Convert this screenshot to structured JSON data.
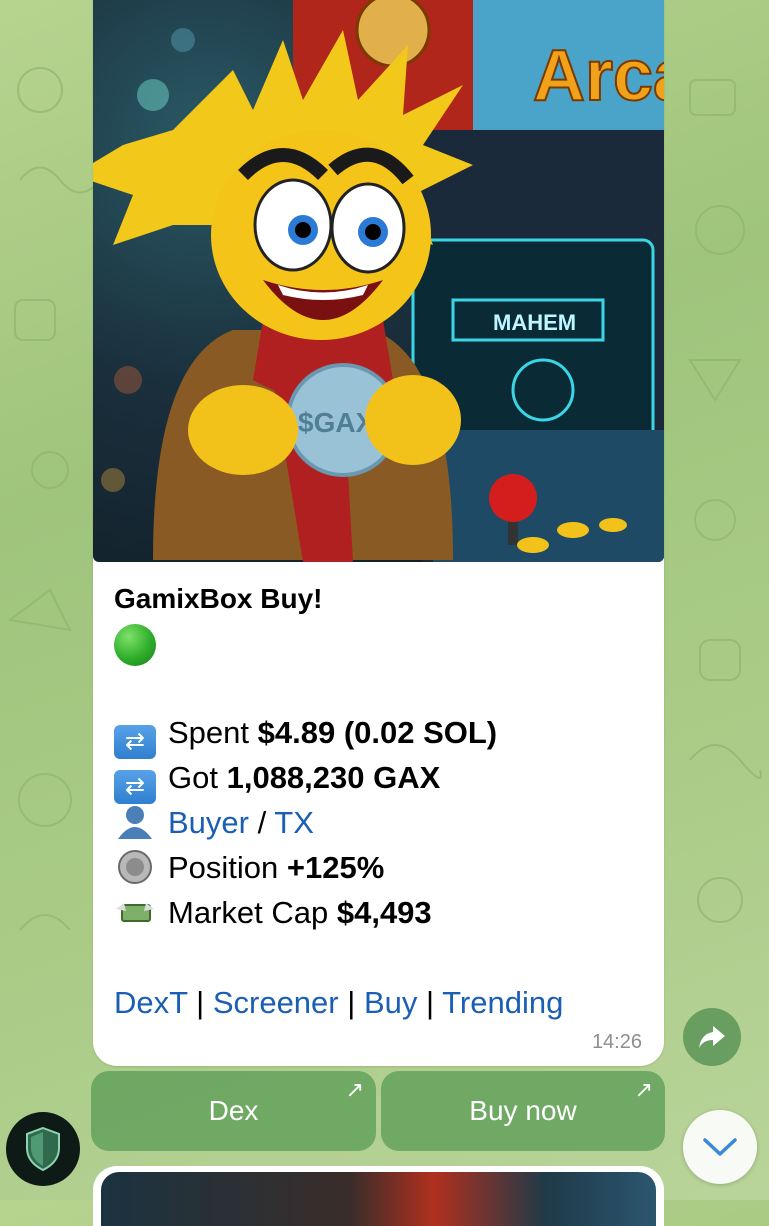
{
  "message": {
    "title": "GamixBox Buy!",
    "lines": [
      {
        "icon": "shuffle-icon",
        "label": "Spent ",
        "value": "$4.89 (0.02 SOL)"
      },
      {
        "icon": "shuffle-icon",
        "label": "Got ",
        "value": "1,088,230 GAX"
      },
      {
        "icon": "person-silhouette-icon",
        "link1": "Buyer",
        "sep": " / ",
        "link2": "TX"
      },
      {
        "icon": "coin-icon",
        "label": "Position ",
        "value": "+125%"
      },
      {
        "icon": "money-with-wings-icon",
        "label": "Market Cap ",
        "value": "$4,493"
      }
    ],
    "links": [
      "DexT",
      "Screener",
      "Buy",
      "Trending"
    ],
    "time": "14:26",
    "image": {
      "coin_text": "$GAX",
      "marquee_text": "Arcad",
      "screen_text": "MAHEM"
    }
  },
  "buttons": {
    "left": "Dex",
    "right": "Buy now"
  },
  "colors": {
    "link": "#1a5fb4",
    "button_bg": "#60a05a",
    "status_dot": "#2fae2a"
  }
}
